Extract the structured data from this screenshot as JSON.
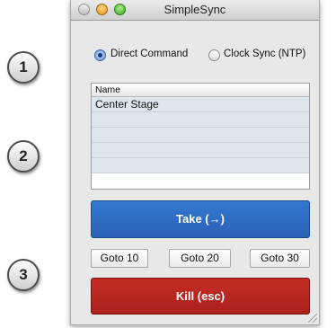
{
  "callouts": [
    "1",
    "2",
    "3"
  ],
  "window": {
    "title": "SimpleSync"
  },
  "sync_mode": {
    "options": [
      {
        "label": "Direct Command",
        "selected": true
      },
      {
        "label": "Clock Sync (NTP)",
        "selected": false
      }
    ]
  },
  "list": {
    "header": "Name",
    "rows": [
      "Center Stage",
      "",
      "",
      "",
      ""
    ]
  },
  "buttons": {
    "take": "Take (→)",
    "goto": [
      "Goto 10",
      "Goto 20",
      "Goto 30"
    ],
    "kill": "Kill (esc)"
  },
  "colors": {
    "take_button": "#2f6ec7",
    "kill_button": "#b8261f",
    "list_row": "#dde6ee"
  }
}
